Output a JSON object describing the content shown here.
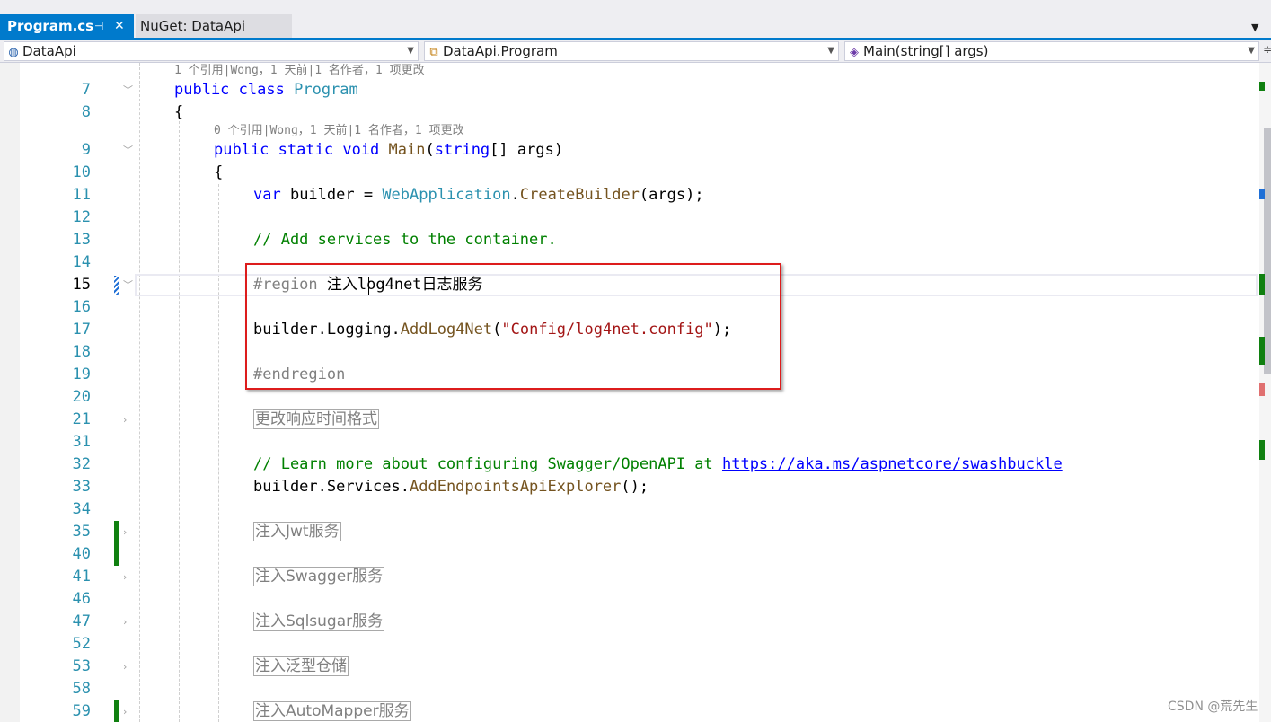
{
  "tabs": [
    {
      "label": "Program.cs",
      "active": true,
      "pin_icon": "pin-icon",
      "close_icon": "close-icon"
    },
    {
      "label": "NuGet: DataApi",
      "active": false
    }
  ],
  "nav": {
    "project": {
      "icon": "globe-icon",
      "label": "DataApi"
    },
    "class": {
      "icon": "class-icon",
      "label": "DataApi.Program"
    },
    "member": {
      "icon": "method-cube-icon",
      "label": "Main(string[] args)"
    }
  },
  "codelens": {
    "class": "1 个引用|Wong，1 天前|1 名作者，1 项更改",
    "main": "0 个引用|Wong，1 天前|1 名作者，1 项更改"
  },
  "line_numbers": [
    "7",
    "8",
    "9",
    "10",
    "11",
    "12",
    "13",
    "14",
    "15",
    "16",
    "17",
    "18",
    "19",
    "20",
    "21",
    "31",
    "32",
    "33",
    "34",
    "35",
    "40",
    "41",
    "46",
    "47",
    "52",
    "53",
    "58",
    "59"
  ],
  "current_line": "15",
  "code": {
    "l7": {
      "kw1": "public",
      "kw2": "class",
      "type": "Program"
    },
    "l8": {
      "text": "{"
    },
    "l9": {
      "kw1": "public",
      "kw2": "static",
      "kw3": "void",
      "method": "Main",
      "p1": "(",
      "kw4": "string",
      "p2": "[] args)"
    },
    "l10": {
      "text": "{"
    },
    "l11": {
      "kw": "var",
      "t1": " builder = ",
      "type": "WebApplication",
      "dot": ".",
      "method": "CreateBuilder",
      "t2": "(args);"
    },
    "l13": {
      "comment": "// Add services to the container."
    },
    "l15": {
      "directive": "#region",
      "name": " 注入log4net日志服务"
    },
    "l17": {
      "t1": "builder.Logging.",
      "method": "AddLog4Net",
      "p1": "(",
      "string": "\"Config/log4net.config\"",
      "p2": ");"
    },
    "l19": {
      "directive": "#endregion"
    },
    "l21": {
      "collapsed": "更改响应时间格式"
    },
    "l32": {
      "comment": "// Learn more about configuring Swagger/OpenAPI at ",
      "link": "https://aka.ms/aspnetcore/swashbuckle"
    },
    "l33": {
      "t1": "builder.Services.",
      "method": "AddEndpointsApiExplorer",
      "t2": "();"
    },
    "l35": {
      "collapsed": "注入Jwt服务"
    },
    "l41": {
      "collapsed": "注入Swagger服务"
    },
    "l47": {
      "collapsed": "注入Sqlsugar服务"
    },
    "l53": {
      "collapsed": "注入泛型仓储"
    },
    "l59": {
      "collapsed": "注入AutoMapper服务"
    }
  },
  "watermark": "CSDN @荒先生",
  "colors": {
    "accent": "#007acc",
    "keyword": "#0000ff",
    "type": "#2b91af",
    "method": "#74531f",
    "comment": "#008000",
    "string": "#a31515",
    "change_saved": "#108010",
    "annotation_box": "#dd1c1c"
  }
}
